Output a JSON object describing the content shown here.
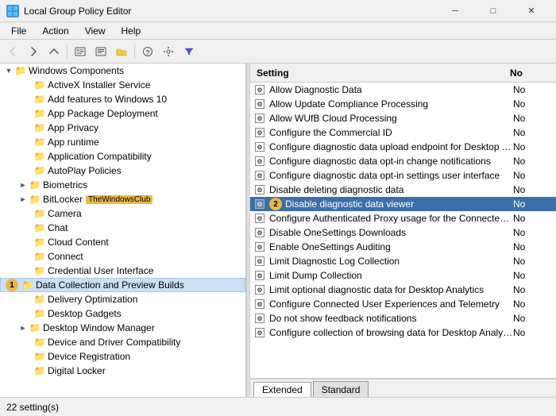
{
  "window": {
    "title": "Local Group Policy Editor",
    "controls": {
      "minimize": "─",
      "maximize": "□",
      "close": "✕"
    }
  },
  "menu": {
    "items": [
      "File",
      "Action",
      "View",
      "Help"
    ]
  },
  "toolbar": {
    "buttons": [
      "←",
      "→",
      "⬆",
      "📋",
      "🖹",
      "📁",
      "📂",
      "🔒",
      "🔍",
      "▼"
    ]
  },
  "left_pane": {
    "items": [
      {
        "level": 1,
        "expand": "▼",
        "label": "Windows Components",
        "type": "folder-open"
      },
      {
        "level": 2,
        "expand": " ",
        "label": "ActiveX Installer Service",
        "type": "folder"
      },
      {
        "level": 2,
        "expand": " ",
        "label": "Add features to Windows 10",
        "type": "folder"
      },
      {
        "level": 2,
        "expand": " ",
        "label": "App Package Deployment",
        "type": "folder"
      },
      {
        "level": 2,
        "expand": " ",
        "label": "App Privacy",
        "type": "folder"
      },
      {
        "level": 2,
        "expand": " ",
        "label": "App runtime",
        "type": "folder"
      },
      {
        "level": 2,
        "expand": " ",
        "label": "Application Compatibility",
        "type": "folder"
      },
      {
        "level": 2,
        "expand": " ",
        "label": "AutoPlay Policies",
        "type": "folder"
      },
      {
        "level": 2,
        "expand": "►",
        "label": "Biometrics",
        "type": "folder"
      },
      {
        "level": 2,
        "expand": "►",
        "label": "BitLocker",
        "type": "folder",
        "badge": "TheWindowsClub"
      },
      {
        "level": 2,
        "expand": " ",
        "label": "Camera",
        "type": "folder"
      },
      {
        "level": 2,
        "expand": " ",
        "label": "Chat",
        "type": "folder"
      },
      {
        "level": 2,
        "expand": " ",
        "label": "Cloud Content",
        "type": "folder"
      },
      {
        "level": 2,
        "expand": " ",
        "label": "Connect",
        "type": "folder"
      },
      {
        "level": 2,
        "expand": " ",
        "label": "Credential User Interface",
        "type": "folder"
      },
      {
        "level": 2,
        "expand": " ",
        "label": "Data Collection and Preview Builds",
        "type": "folder",
        "selected": true,
        "number": "1"
      },
      {
        "level": 2,
        "expand": " ",
        "label": "Delivery Optimization",
        "type": "folder"
      },
      {
        "level": 2,
        "expand": " ",
        "label": "Desktop Gadgets",
        "type": "folder"
      },
      {
        "level": 2,
        "expand": "►",
        "label": "Desktop Window Manager",
        "type": "folder"
      },
      {
        "level": 2,
        "expand": " ",
        "label": "Device and Driver Compatibility",
        "type": "folder"
      },
      {
        "level": 2,
        "expand": " ",
        "label": "Device Registration",
        "type": "folder"
      },
      {
        "level": 2,
        "expand": " ",
        "label": "Digital Locker",
        "type": "folder"
      }
    ]
  },
  "right_pane": {
    "columns": {
      "setting": "Setting",
      "state": "No"
    },
    "items": [
      {
        "label": "Allow Diagnostic Data",
        "state": "No",
        "selected": false
      },
      {
        "label": "Allow Update Compliance Processing",
        "state": "No",
        "selected": false
      },
      {
        "label": "Allow WUfB Cloud Processing",
        "state": "No",
        "selected": false
      },
      {
        "label": "Configure the Commercial ID",
        "state": "No",
        "selected": false
      },
      {
        "label": "Configure diagnostic data upload endpoint for Desktop Ana...",
        "state": "No",
        "selected": false
      },
      {
        "label": "Configure diagnostic data opt-in change notifications",
        "state": "No",
        "selected": false
      },
      {
        "label": "Configure diagnostic data opt-in settings user interface",
        "state": "No",
        "selected": false
      },
      {
        "label": "Disable deleting diagnostic data",
        "state": "No",
        "selected": false
      },
      {
        "label": "Disable diagnostic data viewer",
        "state": "No",
        "selected": true,
        "number": "2"
      },
      {
        "label": "Configure Authenticated Proxy usage for the Connected Us...",
        "state": "No",
        "selected": false
      },
      {
        "label": "Disable OneSettings Downloads",
        "state": "No",
        "selected": false
      },
      {
        "label": "Enable OneSettings Auditing",
        "state": "No",
        "selected": false
      },
      {
        "label": "Limit Diagnostic Log Collection",
        "state": "No",
        "selected": false
      },
      {
        "label": "Limit Dump Collection",
        "state": "No",
        "selected": false
      },
      {
        "label": "Limit optional diagnostic data for Desktop Analytics",
        "state": "No",
        "selected": false
      },
      {
        "label": "Configure Connected User Experiences and Telemetry",
        "state": "No",
        "selected": false
      },
      {
        "label": "Do not show feedback notifications",
        "state": "No",
        "selected": false
      },
      {
        "label": "Configure collection of browsing data for Desktop Analytics",
        "state": "No",
        "selected": false
      }
    ]
  },
  "tabs": [
    "Extended",
    "Standard"
  ],
  "active_tab": "Extended",
  "status_bar": {
    "text": "22 setting(s)"
  }
}
